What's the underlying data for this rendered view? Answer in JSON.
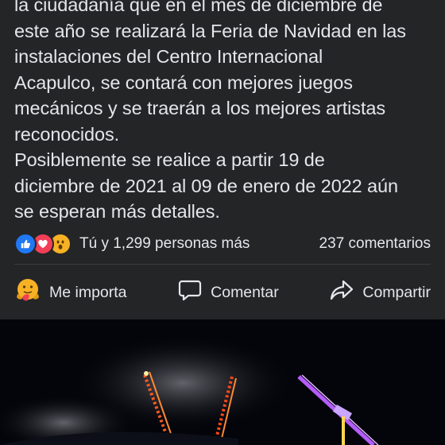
{
  "post": {
    "text": "la ciudadanía que en el mes de diciembre de\neste año se realizará la Feria de Navidad en las\ninstalaciones del Centro Internacional\nAcapulco, se contará con mejores juegos\nmecánicos y se traerán a los mejores artistas\nreconocidos.\nPosiblemente se realice a partir 19 de\ndiciembre de 2021 al 09 de enero de 2022 aún\nse esperan más detalles."
  },
  "reactions": {
    "icons": [
      "like-icon",
      "love-icon",
      "wow-icon"
    ],
    "summary": "Tú y 1,299 personas más",
    "comments": "237 comentarios"
  },
  "actions": {
    "care_label": "Me importa",
    "comment_label": "Comentar",
    "share_label": "Compartir"
  },
  "colors": {
    "background": "#242526",
    "text": "#e4e6eb",
    "like": "#2078f4",
    "love": "#f33e58",
    "wow": "#f7b125"
  }
}
